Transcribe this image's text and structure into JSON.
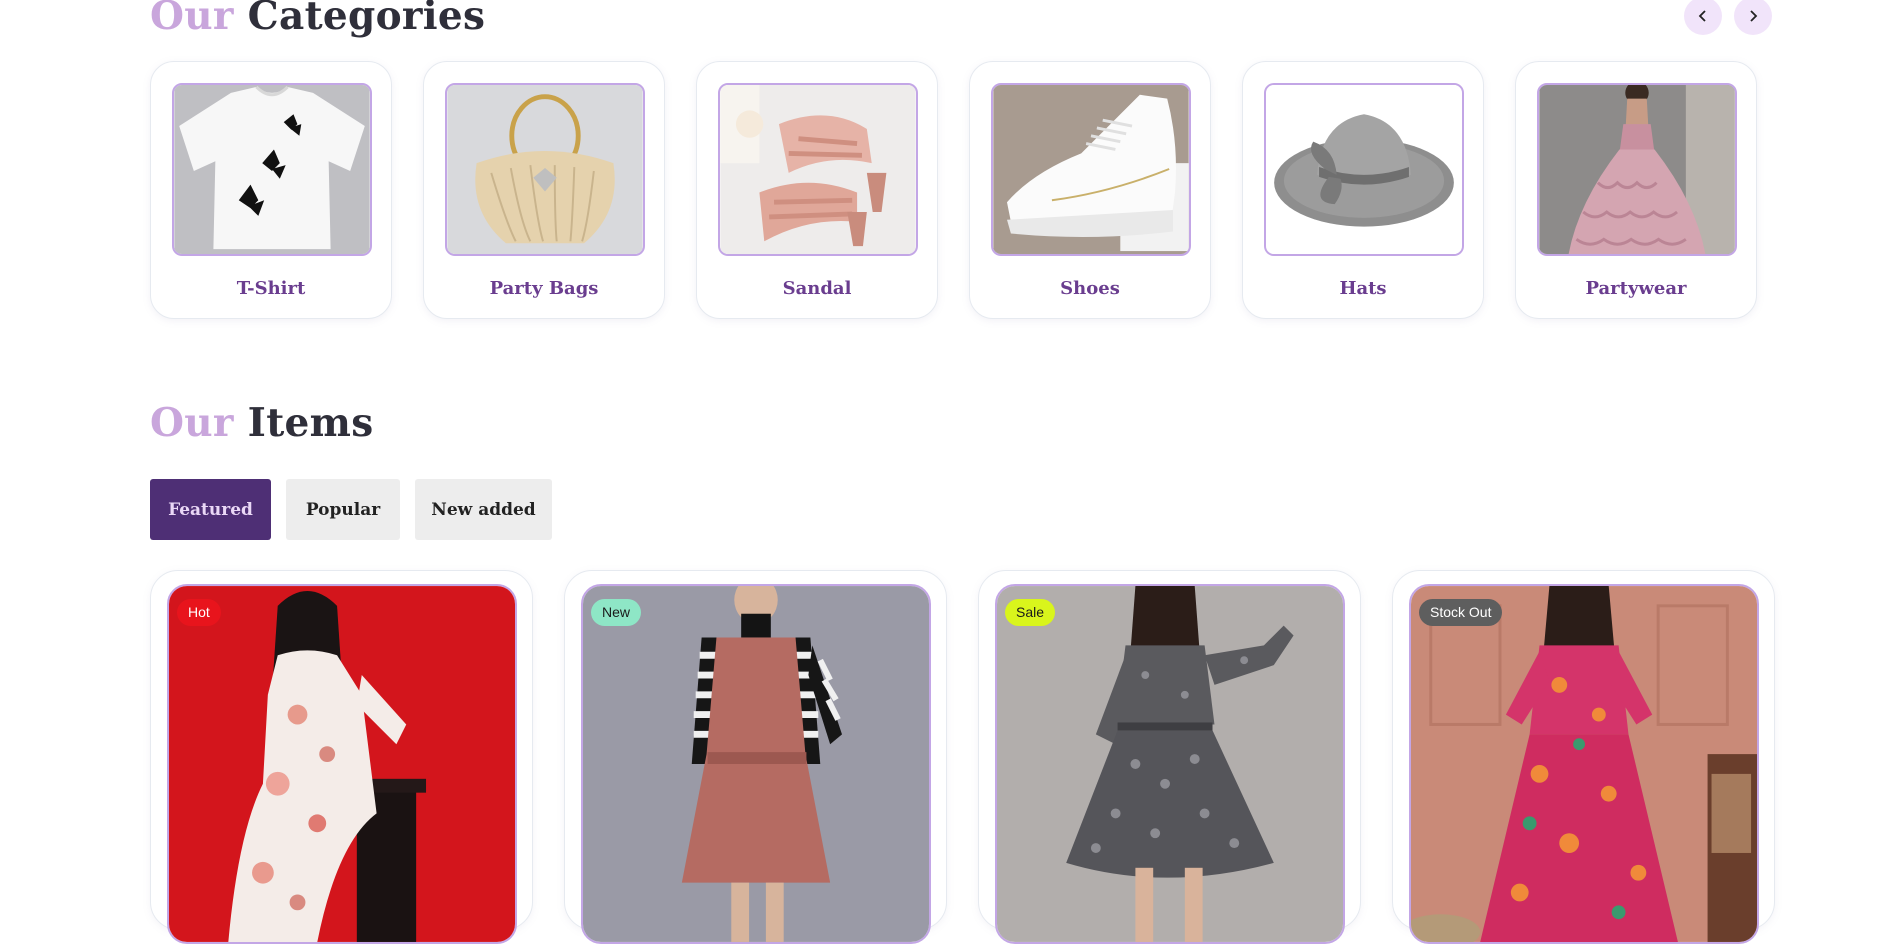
{
  "categories": {
    "title_accent": "Our",
    "title_main": "Categories",
    "prev_icon": "chevron-left-icon",
    "next_icon": "chevron-right-icon",
    "items": [
      {
        "label": "T-Shirt"
      },
      {
        "label": "Party Bags"
      },
      {
        "label": "Sandal"
      },
      {
        "label": "Shoes"
      },
      {
        "label": "Hats"
      },
      {
        "label": "Partywear"
      }
    ]
  },
  "items": {
    "title_accent": "Our",
    "title_main": "Items",
    "tabs": [
      {
        "label": "Featured",
        "active": true
      },
      {
        "label": "Popular",
        "active": false
      },
      {
        "label": "New added",
        "active": false
      }
    ],
    "products": [
      {
        "badge": "Hot",
        "badge_color": "#e8141c",
        "badge_text_color": "#ffffff"
      },
      {
        "badge": "New",
        "badge_color": "#8ee6c6",
        "badge_text_color": "#1a1a1a"
      },
      {
        "badge": "Sale",
        "badge_color": "#d9f51c",
        "badge_text_color": "#1a1a1a"
      },
      {
        "badge": "Stock Out",
        "badge_color": "#5e5e5e",
        "badge_text_color": "#ffffff"
      }
    ]
  },
  "colors": {
    "accent": "#c9a6dc",
    "brand_dark": "#4e2f75",
    "card_border": "#c3a6e6",
    "label": "#6a3d8f"
  }
}
